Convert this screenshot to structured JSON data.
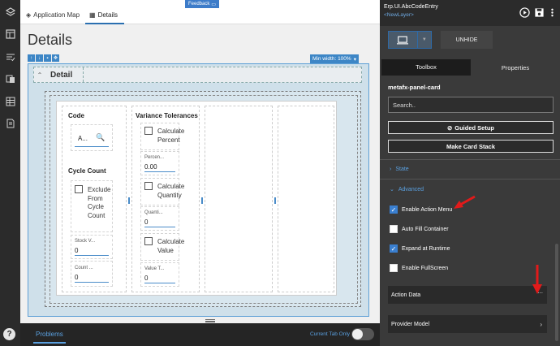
{
  "tabs": [
    {
      "label": "Application Map",
      "icon": "layers-icon"
    },
    {
      "label": "Details",
      "icon": "grid-icon"
    }
  ],
  "feedback_label": "Feedback",
  "page_title": "Details",
  "min_width_label": "Min width: 100%",
  "detail_header": "Detail",
  "columns": {
    "code": {
      "title": "Code",
      "field_value": "A..."
    },
    "cycle_count": {
      "title": "Cycle Count",
      "checkbox_label": "Exclude From Cycle Count",
      "stock_label": "Stock V...",
      "stock_value": "0",
      "count_label": "Count ...",
      "count_value": "0"
    },
    "variance": {
      "title": "Variance Tolerances",
      "calc_percent": "Calculate Percent",
      "percent_label": "Percen...",
      "percent_value": "0.00",
      "calc_quantity": "Calculate Quantity",
      "quantity_label": "Quanti...",
      "quantity_value": "0",
      "calc_value": "Calculate Value",
      "value_label": "Value T...",
      "value_value": "0"
    }
  },
  "bottom": {
    "problems_label": "Problems",
    "current_tab_only": "Current Tab Only"
  },
  "right": {
    "title": "Erp.UI.AbcCodeEntry",
    "subtitle": "<NewLayer>",
    "unhide_label": "UNHIDE",
    "tab_toolbox": "Toolbox",
    "tab_properties": "Properties",
    "panel_name": "metafx-panel-card",
    "search_placeholder": "Search..",
    "guided_setup": "Guided Setup",
    "make_card_stack": "Make Card Stack",
    "state_label": "State",
    "advanced_label": "Advanced",
    "options": [
      {
        "label": "Enable Action Menu",
        "checked": true
      },
      {
        "label": "Auto Fill Container",
        "checked": false
      },
      {
        "label": "Expand at Runtime",
        "checked": true
      },
      {
        "label": "Enable FullScreen",
        "checked": false
      }
    ],
    "action_data": "Action Data",
    "provider_model": "Provider Model",
    "more_glyph": "...",
    "arrow_glyph": "›"
  },
  "colors": {
    "accent": "#3d86c6",
    "annotation": "#e21a1a"
  }
}
